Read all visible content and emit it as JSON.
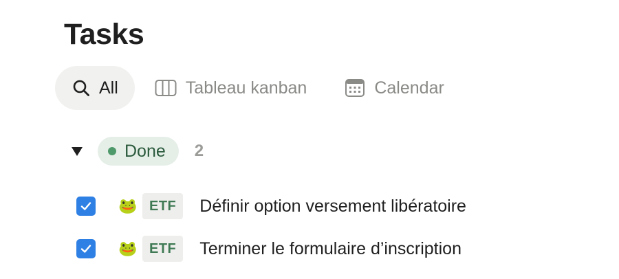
{
  "page": {
    "title": "Tasks"
  },
  "views": [
    {
      "label": "All",
      "icon": "search-icon",
      "active": true
    },
    {
      "label": "Tableau kanban",
      "icon": "board-columns-icon",
      "active": false
    },
    {
      "label": "Calendar",
      "icon": "calendar-icon",
      "active": false
    }
  ],
  "group": {
    "status_label": "Done",
    "status_color": "#4e9a6a",
    "count": "2",
    "expanded": true
  },
  "tasks": [
    {
      "emoji": "🐸",
      "tag": "ETF",
      "title": "Définir option versement libératoire",
      "checked": true
    },
    {
      "emoji": "🐸",
      "tag": "ETF",
      "title": "Terminer le formulaire d’inscription",
      "checked": true
    }
  ],
  "colors": {
    "checkbox": "#2f80e4",
    "tag_text": "#3f7a55",
    "pill_bg": "#e5efe8"
  }
}
